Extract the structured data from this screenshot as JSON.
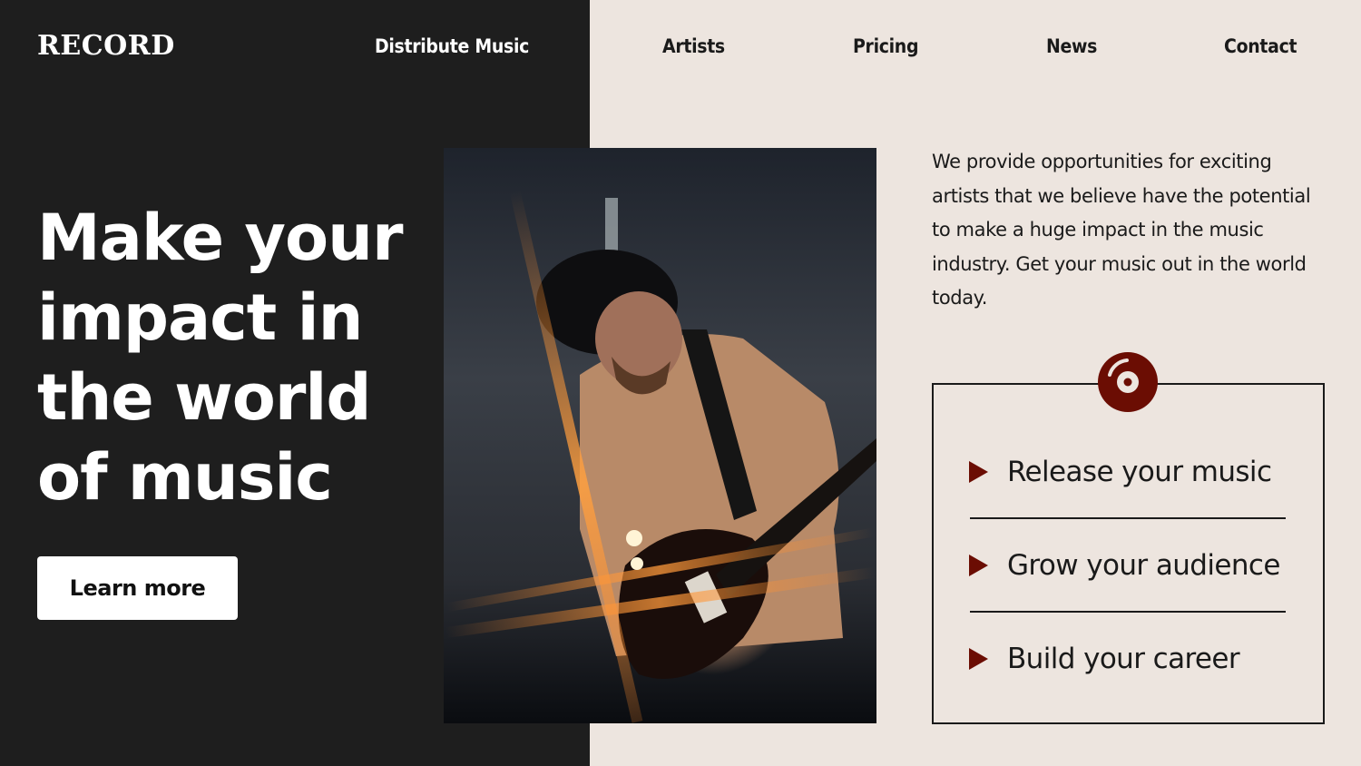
{
  "brand": {
    "logo": "RECORD"
  },
  "nav": {
    "items": [
      {
        "label": "Distribute Music"
      },
      {
        "label": "Artists"
      },
      {
        "label": "Pricing"
      },
      {
        "label": "News"
      },
      {
        "label": "Contact"
      }
    ]
  },
  "hero": {
    "headline_lines": [
      "Make your",
      "impact in",
      "the world",
      "of music"
    ],
    "cta_label": "Learn more",
    "image_alt": "Musician in beanie playing an electric guitar with orange lens flare"
  },
  "intro": {
    "text": "We provide opportunities for exciting artists that we believe have the potential to make a huge impact in the music industry. Get your music out in the world today."
  },
  "features": {
    "icon": "vinyl-disc-icon",
    "items": [
      {
        "label": "Release your music",
        "icon": "play-triangle-icon"
      },
      {
        "label": "Grow your audience",
        "icon": "play-triangle-icon"
      },
      {
        "label": "Build your career",
        "icon": "play-triangle-icon"
      }
    ]
  },
  "colors": {
    "dark_bg": "#1e1e1e",
    "light_bg": "#ede5df",
    "accent": "#6b0d03",
    "text_dark": "#1a1a1a",
    "text_light": "#ffffff"
  }
}
